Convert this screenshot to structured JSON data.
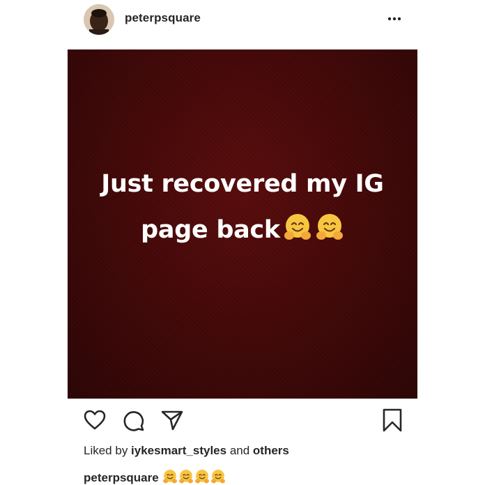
{
  "header": {
    "username": "peterpsquare",
    "more_icon": "more-dots-icon"
  },
  "post": {
    "line1": "Just recovered my IG",
    "line2": "page back",
    "emoji": "hugging-face",
    "background_color": "#4a0a0a"
  },
  "actions": {
    "icons": [
      "heart-icon",
      "comment-icon",
      "share-icon",
      "bookmark-icon"
    ]
  },
  "likes": {
    "prefix": "Liked by ",
    "user": "iykesmart_styles",
    "middle": " and ",
    "others": "others"
  },
  "caption": {
    "username": "peterpsquare",
    "emoji_count": 4
  }
}
